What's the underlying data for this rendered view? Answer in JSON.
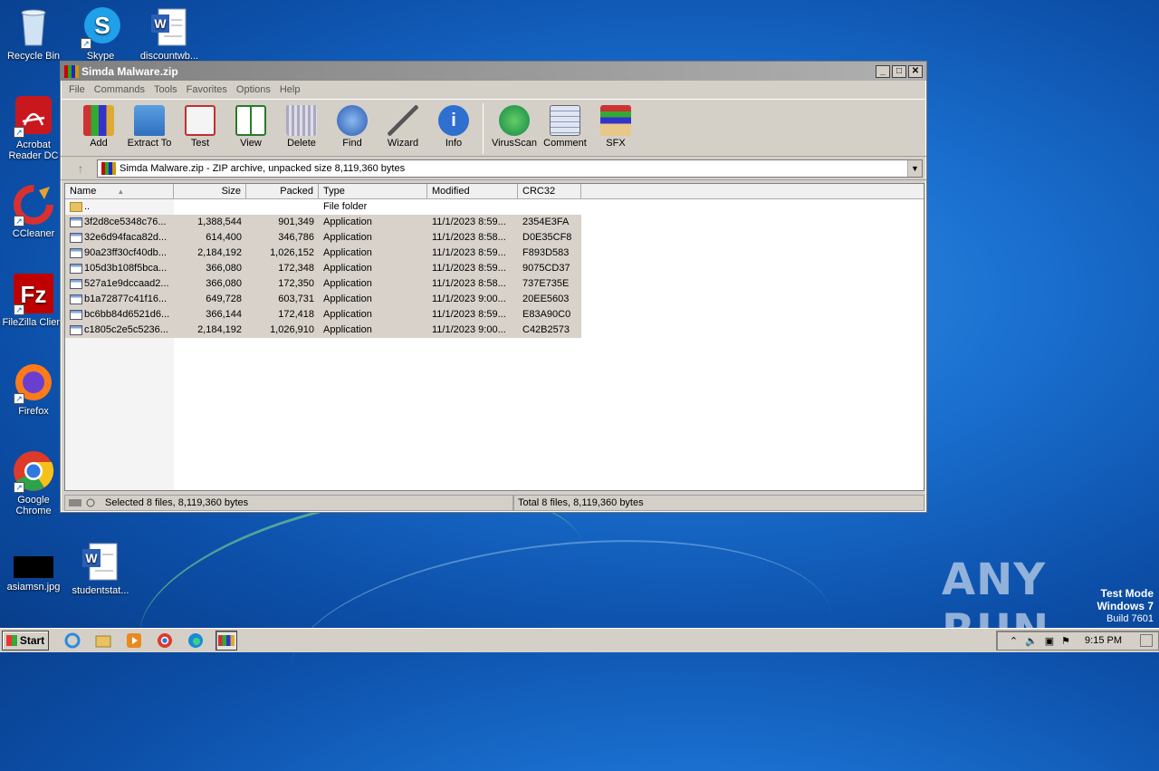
{
  "desktop": {
    "icons": [
      {
        "label": "Recycle Bin"
      },
      {
        "label": "Skype"
      },
      {
        "label": "discountwb..."
      },
      {
        "label": "Acrobat Reader DC"
      },
      {
        "label": "CCleaner"
      },
      {
        "label": "FileZilla Client"
      },
      {
        "label": "Firefox"
      },
      {
        "label": "Google Chrome"
      },
      {
        "label": "asiamsn.jpg"
      },
      {
        "label": "studentstat..."
      }
    ],
    "watermark": "ANY RUN",
    "testmode": {
      "line1": "Test Mode",
      "line2": "Windows 7",
      "line3": "Build 7601"
    }
  },
  "window": {
    "title": "Simda Malware.zip",
    "controls": {
      "minimize": "_",
      "maximize": "□",
      "close": "✕"
    },
    "menu": [
      "File",
      "Commands",
      "Tools",
      "Favorites",
      "Options",
      "Help"
    ],
    "toolbar": [
      "Add",
      "Extract To",
      "Test",
      "View",
      "Delete",
      "Find",
      "Wizard",
      "Info",
      "VirusScan",
      "Comment",
      "SFX"
    ],
    "address": "Simda Malware.zip - ZIP archive, unpacked size 8,119,360 bytes",
    "columns": [
      "Name",
      "Size",
      "Packed",
      "Type",
      "Modified",
      "CRC32"
    ],
    "parent_row": {
      "name": "..",
      "type": "File folder"
    },
    "files": [
      {
        "name": "3f2d8ce5348c76...",
        "size": "1,388,544",
        "packed": "901,349",
        "type": "Application",
        "modified": "11/1/2023 8:59...",
        "crc": "2354E3FA"
      },
      {
        "name": "32e6d94faca82d...",
        "size": "614,400",
        "packed": "346,786",
        "type": "Application",
        "modified": "11/1/2023 8:58...",
        "crc": "D0E35CF8"
      },
      {
        "name": "90a23ff30cf40db...",
        "size": "2,184,192",
        "packed": "1,026,152",
        "type": "Application",
        "modified": "11/1/2023 8:59...",
        "crc": "F893D583"
      },
      {
        "name": "105d3b108f5bca...",
        "size": "366,080",
        "packed": "172,348",
        "type": "Application",
        "modified": "11/1/2023 8:59...",
        "crc": "9075CD37"
      },
      {
        "name": "527a1e9dccaad2...",
        "size": "366,080",
        "packed": "172,350",
        "type": "Application",
        "modified": "11/1/2023 8:58...",
        "crc": "737E735E"
      },
      {
        "name": "b1a72877c41f16...",
        "size": "649,728",
        "packed": "603,731",
        "type": "Application",
        "modified": "11/1/2023 9:00...",
        "crc": "20EE5603"
      },
      {
        "name": "bc6bb84d6521d6...",
        "size": "366,144",
        "packed": "172,418",
        "type": "Application",
        "modified": "11/1/2023 8:59...",
        "crc": "E83A90C0"
      },
      {
        "name": "c1805c2e5c5236...",
        "size": "2,184,192",
        "packed": "1,026,910",
        "type": "Application",
        "modified": "11/1/2023 9:00...",
        "crc": "C42B2573"
      }
    ],
    "status_left": "Selected 8 files, 8,119,360 bytes",
    "status_right": "Total 8 files, 8,119,360 bytes"
  },
  "taskbar": {
    "start": "Start",
    "clock": "9:15 PM"
  }
}
